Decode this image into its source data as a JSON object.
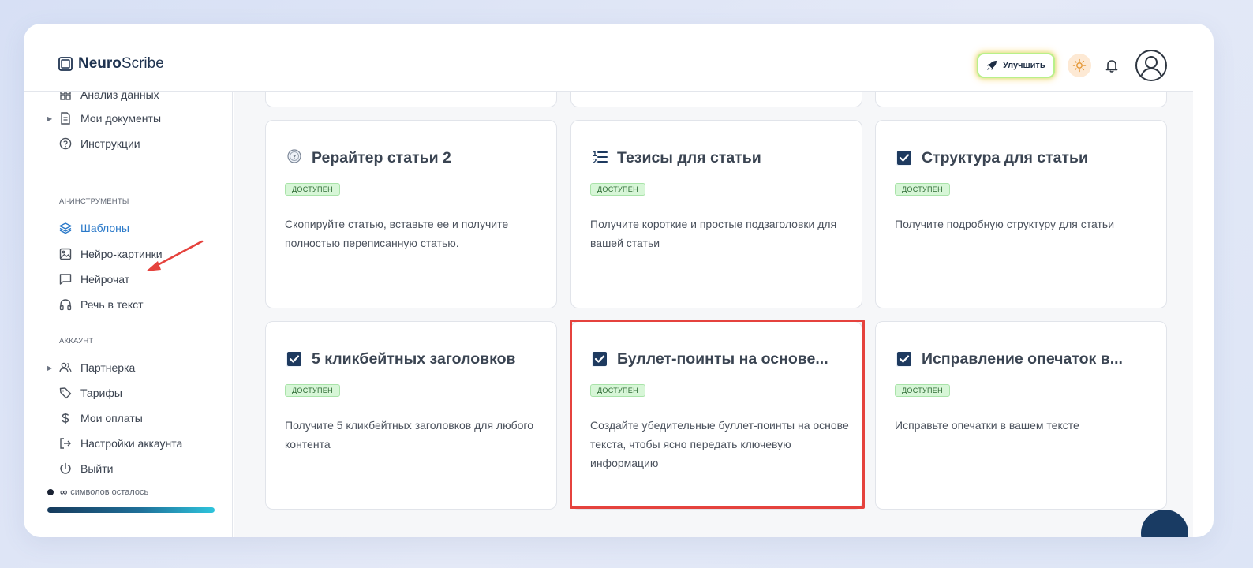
{
  "header": {
    "logo_strong": "Neuro",
    "logo_light": "Scribe",
    "upgrade_label": "Улучшить"
  },
  "sidebar": {
    "items_top": [
      {
        "label": "Анализ данных",
        "icon": "grid-icon"
      },
      {
        "label": "Мои документы",
        "icon": "document-icon",
        "expandable": true
      },
      {
        "label": "Инструкции",
        "icon": "help-circle-icon"
      }
    ],
    "section_ai": "AI-ИНСТРУМЕНТЫ",
    "items_ai": [
      {
        "label": "Шаблоны",
        "icon": "layers-icon",
        "active": true
      },
      {
        "label": "Нейро-картинки",
        "icon": "image-icon"
      },
      {
        "label": "Нейрочат",
        "icon": "chat-icon"
      },
      {
        "label": "Речь в текст",
        "icon": "headphones-icon"
      }
    ],
    "section_account": "АККАУНТ",
    "items_account": [
      {
        "label": "Партнерка",
        "icon": "users-icon",
        "expandable": true
      },
      {
        "label": "Тарифы",
        "icon": "tag-icon"
      },
      {
        "label": "Мои оплаты",
        "icon": "dollar-icon"
      },
      {
        "label": "Настройки аккаунта",
        "icon": "login-icon"
      },
      {
        "label": "Выйти",
        "icon": "power-icon"
      }
    ],
    "credits_symbol": "∞",
    "credits_label": "символов осталось"
  },
  "cards": [
    {
      "title": "Рерайтер статьи 2",
      "badge": "ДОСТУПЕН",
      "icon": "clock-icon",
      "desc": "Скопируйте статью, вставьте ее и получите полностью переписанную статью."
    },
    {
      "title": "Тезисы для статьи",
      "badge": "ДОСТУПЕН",
      "icon": "numbered-list-icon",
      "desc": "Получите короткие и простые подзаголовки для вашей статьи"
    },
    {
      "title": "Структура для статьи",
      "badge": "ДОСТУПЕН",
      "icon": "checkbox-icon",
      "desc": "Получите подробную структуру для статьи"
    },
    {
      "title": "5 кликбейтных заголовков",
      "badge": "ДОСТУПЕН",
      "icon": "checkbox-icon",
      "desc": "Получите 5 кликбейтных заголовков для любого контента"
    },
    {
      "title": "Буллет-поинты на основе...",
      "badge": "ДОСТУПЕН",
      "icon": "checkbox-icon",
      "desc": "Создайте убедительные буллет-поинты на основе текста, чтобы ясно передать ключевую информацию"
    },
    {
      "title": "Исправление опечаток в...",
      "badge": "ДОСТУПЕН",
      "icon": "checkbox-icon",
      "desc": "Исправьте опечатки в вашем тексте"
    }
  ],
  "colors": {
    "accent": "#2a79c9",
    "annotation": "#e5423d",
    "badge_bg": "#d7f6d7",
    "badge_text": "#2f6c35"
  }
}
